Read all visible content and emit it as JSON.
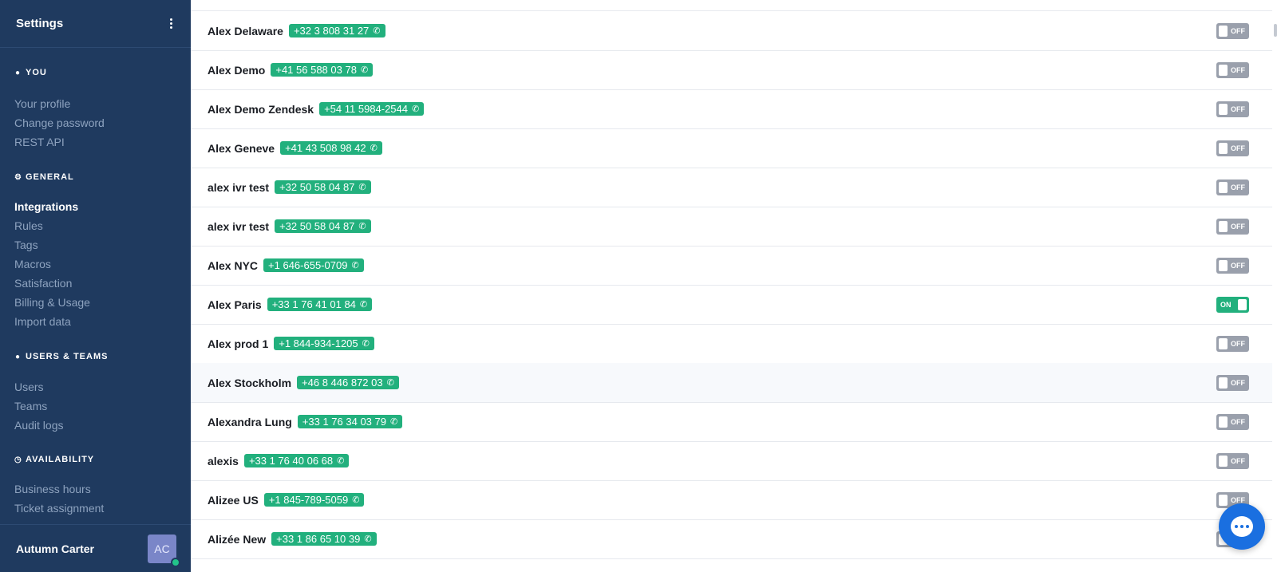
{
  "sidebar": {
    "title": "Settings",
    "sections": [
      {
        "label": "YOU",
        "icon": "person-icon",
        "items": [
          "Your profile",
          "Change password",
          "REST API"
        ]
      },
      {
        "label": "GENERAL",
        "icon": "gear-icon",
        "items": [
          "Integrations",
          "Rules",
          "Tags",
          "Macros",
          "Satisfaction",
          "Billing & Usage",
          "Import data"
        ]
      },
      {
        "label": "USERS & TEAMS",
        "icon": "users-icon",
        "items": [
          "Users",
          "Teams",
          "Audit logs"
        ]
      },
      {
        "label": "AVAILABILITY",
        "icon": "clock-icon",
        "items": [
          "Business hours",
          "Ticket assignment"
        ]
      }
    ],
    "active_item": "Integrations",
    "user": {
      "name": "Autumn Carter",
      "initials": "AC",
      "status": "online"
    }
  },
  "integrations": [
    {
      "name": "Alex Delaware",
      "phone": "+32 3 808 31 27",
      "toggle": "OFF"
    },
    {
      "name": "Alex Demo",
      "phone": "+41 56 588 03 78",
      "toggle": "OFF"
    },
    {
      "name": "Alex Demo Zendesk",
      "phone": "+54 11 5984-2544",
      "toggle": "OFF"
    },
    {
      "name": "Alex Geneve",
      "phone": "+41 43 508 98 42",
      "toggle": "OFF"
    },
    {
      "name": "alex ivr test",
      "phone": "+32 50 58 04 87",
      "toggle": "OFF"
    },
    {
      "name": "alex ivr test",
      "phone": "+32 50 58 04 87",
      "toggle": "OFF"
    },
    {
      "name": "Alex NYC",
      "phone": "+1 646-655-0709",
      "toggle": "OFF"
    },
    {
      "name": "Alex Paris",
      "phone": "+33 1 76 41 01 84",
      "toggle": "ON"
    },
    {
      "name": "Alex prod 1",
      "phone": "+1 844-934-1205",
      "toggle": "OFF"
    },
    {
      "name": "Alex Stockholm",
      "phone": "+46 8 446 872 03",
      "toggle": "OFF"
    },
    {
      "name": "Alexandra Lung",
      "phone": "+33 1 76 34 03 79",
      "toggle": "OFF"
    },
    {
      "name": "alexis",
      "phone": "+33 1 76 40 06 68",
      "toggle": "OFF"
    },
    {
      "name": "Alizee US",
      "phone": "+1 845-789-5059",
      "toggle": "OFF"
    },
    {
      "name": "Alizée New",
      "phone": "+33 1 86 65 10 39",
      "toggle": "OFF"
    }
  ],
  "icons": {
    "phone": "phone-icon",
    "chat": "chat-icon",
    "menu": "more-vertical-icon"
  },
  "colors": {
    "sidebar_bg": "#1f3a5f",
    "phone_badge": "#22b07d",
    "toggle_on": "#22b07d",
    "toggle_off": "#9aa0ac",
    "chat_button": "#1a6fe0"
  }
}
